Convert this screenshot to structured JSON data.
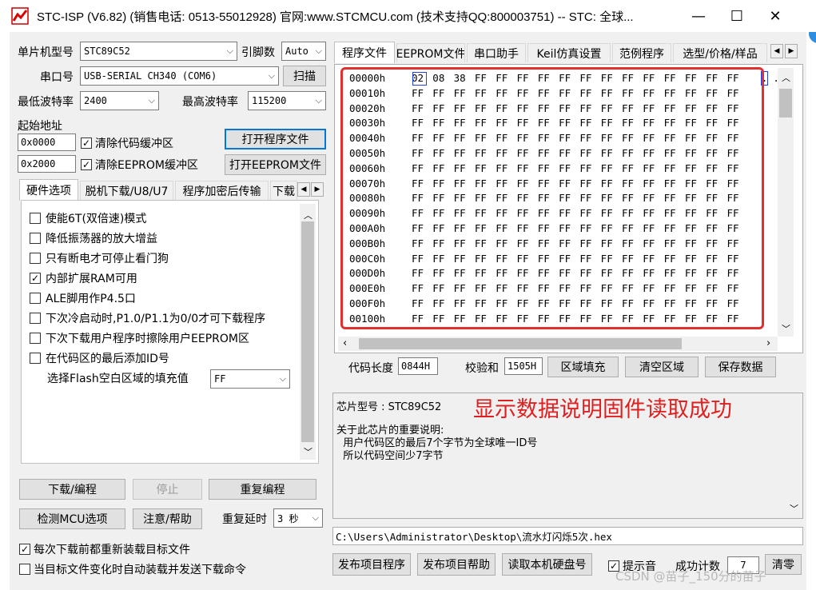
{
  "window": {
    "title": "STC-ISP (V6.82) (销售电话: 0513-55012928) 官网:www.STCMCU.com  (技术支持QQ:800003751)  -- STC: 全球...",
    "minimize": "—",
    "maximize": "☐",
    "close": "✕"
  },
  "left": {
    "mcu_label": "单片机型号",
    "mcu_value": "STC89C52",
    "pins_label": "引脚数",
    "pins_value": "Auto",
    "port_label": "串口号",
    "port_value": "USB-SERIAL CH340 (COM6)",
    "scan_button": "扫描",
    "min_baud_label": "最低波特率",
    "min_baud_value": "2400",
    "max_baud_label": "最高波特率",
    "max_baud_value": "115200",
    "start_addr_label": "起始地址",
    "addr1": "0x0000",
    "clear_code_label": "清除代码缓冲区",
    "open_prog_button": "打开程序文件",
    "addr2": "0x2000",
    "clear_eeprom_label": "清除EEPROM缓冲区",
    "open_eeprom_button": "打开EEPROM文件",
    "tabs": [
      "硬件选项",
      "脱机下载/U8/U7",
      "程序加密后传输",
      "下载"
    ],
    "options": [
      {
        "label": "使能6T(双倍速)模式",
        "checked": false
      },
      {
        "label": "降低振荡器的放大增益",
        "checked": false
      },
      {
        "label": "只有断电才可停止看门狗",
        "checked": false
      },
      {
        "label": "内部扩展RAM可用",
        "checked": true
      },
      {
        "label": "ALE脚用作P4.5口",
        "checked": false
      },
      {
        "label": "下次冷启动时,P1.0/P1.1为0/0才可下载程序",
        "checked": false
      },
      {
        "label": "下次下载用户程序时擦除用户EEPROM区",
        "checked": false
      },
      {
        "label": "在代码区的最后添加ID号",
        "checked": false
      }
    ],
    "fill_label": "选择Flash空白区域的填充值",
    "fill_value": "FF",
    "download_button": "下载/编程",
    "stop_button": "停止",
    "reprogram_button": "重复编程",
    "detect_button": "检测MCU选项",
    "help_button": "注意/帮助",
    "delay_label": "重复延时",
    "delay_value": "3 秒",
    "reload_label": "每次下载前都重新装载目标文件",
    "autoload_label": "当目标文件变化时自动装载并发送下载命令"
  },
  "right": {
    "tabs": [
      "程序文件",
      "EEPROM文件",
      "串口助手",
      "Keil仿真设置",
      "范例程序",
      "选型/价格/样品"
    ],
    "hex_rows": [
      {
        "addr": "00000h",
        "bytes": [
          "02",
          "08",
          "38",
          "FF",
          "FF",
          "FF",
          "FF",
          "FF",
          "FF",
          "FF",
          "FF",
          "FF",
          "FF",
          "FF",
          "FF",
          "FF"
        ]
      },
      {
        "addr": "00010h",
        "bytes": [
          "FF",
          "FF",
          "FF",
          "FF",
          "FF",
          "FF",
          "FF",
          "FF",
          "FF",
          "FF",
          "FF",
          "FF",
          "FF",
          "FF",
          "FF",
          "FF"
        ]
      },
      {
        "addr": "00020h",
        "bytes": [
          "FF",
          "FF",
          "FF",
          "FF",
          "FF",
          "FF",
          "FF",
          "FF",
          "FF",
          "FF",
          "FF",
          "FF",
          "FF",
          "FF",
          "FF",
          "FF"
        ]
      },
      {
        "addr": "00030h",
        "bytes": [
          "FF",
          "FF",
          "FF",
          "FF",
          "FF",
          "FF",
          "FF",
          "FF",
          "FF",
          "FF",
          "FF",
          "FF",
          "FF",
          "FF",
          "FF",
          "FF"
        ]
      },
      {
        "addr": "00040h",
        "bytes": [
          "FF",
          "FF",
          "FF",
          "FF",
          "FF",
          "FF",
          "FF",
          "FF",
          "FF",
          "FF",
          "FF",
          "FF",
          "FF",
          "FF",
          "FF",
          "FF"
        ]
      },
      {
        "addr": "00050h",
        "bytes": [
          "FF",
          "FF",
          "FF",
          "FF",
          "FF",
          "FF",
          "FF",
          "FF",
          "FF",
          "FF",
          "FF",
          "FF",
          "FF",
          "FF",
          "FF",
          "FF"
        ]
      },
      {
        "addr": "00060h",
        "bytes": [
          "FF",
          "FF",
          "FF",
          "FF",
          "FF",
          "FF",
          "FF",
          "FF",
          "FF",
          "FF",
          "FF",
          "FF",
          "FF",
          "FF",
          "FF",
          "FF"
        ]
      },
      {
        "addr": "00070h",
        "bytes": [
          "FF",
          "FF",
          "FF",
          "FF",
          "FF",
          "FF",
          "FF",
          "FF",
          "FF",
          "FF",
          "FF",
          "FF",
          "FF",
          "FF",
          "FF",
          "FF"
        ]
      },
      {
        "addr": "00080h",
        "bytes": [
          "FF",
          "FF",
          "FF",
          "FF",
          "FF",
          "FF",
          "FF",
          "FF",
          "FF",
          "FF",
          "FF",
          "FF",
          "FF",
          "FF",
          "FF",
          "FF"
        ]
      },
      {
        "addr": "00090h",
        "bytes": [
          "FF",
          "FF",
          "FF",
          "FF",
          "FF",
          "FF",
          "FF",
          "FF",
          "FF",
          "FF",
          "FF",
          "FF",
          "FF",
          "FF",
          "FF",
          "FF"
        ]
      },
      {
        "addr": "000A0h",
        "bytes": [
          "FF",
          "FF",
          "FF",
          "FF",
          "FF",
          "FF",
          "FF",
          "FF",
          "FF",
          "FF",
          "FF",
          "FF",
          "FF",
          "FF",
          "FF",
          "FF"
        ]
      },
      {
        "addr": "000B0h",
        "bytes": [
          "FF",
          "FF",
          "FF",
          "FF",
          "FF",
          "FF",
          "FF",
          "FF",
          "FF",
          "FF",
          "FF",
          "FF",
          "FF",
          "FF",
          "FF",
          "FF"
        ]
      },
      {
        "addr": "000C0h",
        "bytes": [
          "FF",
          "FF",
          "FF",
          "FF",
          "FF",
          "FF",
          "FF",
          "FF",
          "FF",
          "FF",
          "FF",
          "FF",
          "FF",
          "FF",
          "FF",
          "FF"
        ]
      },
      {
        "addr": "000D0h",
        "bytes": [
          "FF",
          "FF",
          "FF",
          "FF",
          "FF",
          "FF",
          "FF",
          "FF",
          "FF",
          "FF",
          "FF",
          "FF",
          "FF",
          "FF",
          "FF",
          "FF"
        ]
      },
      {
        "addr": "000E0h",
        "bytes": [
          "FF",
          "FF",
          "FF",
          "FF",
          "FF",
          "FF",
          "FF",
          "FF",
          "FF",
          "FF",
          "FF",
          "FF",
          "FF",
          "FF",
          "FF",
          "FF"
        ]
      },
      {
        "addr": "000F0h",
        "bytes": [
          "FF",
          "FF",
          "FF",
          "FF",
          "FF",
          "FF",
          "FF",
          "FF",
          "FF",
          "FF",
          "FF",
          "FF",
          "FF",
          "FF",
          "FF",
          "FF"
        ]
      },
      {
        "addr": "00100h",
        "bytes": [
          "FF",
          "FF",
          "FF",
          "FF",
          "FF",
          "FF",
          "FF",
          "FF",
          "FF",
          "FF",
          "FF",
          "FF",
          "FF",
          "FF",
          "FF",
          "FF"
        ]
      }
    ],
    "ascii_preview": ". .",
    "code_len_label": "代码长度",
    "code_len_value": "0844H",
    "checksum_label": "校验和",
    "checksum_value": "1505H",
    "fill_button": "区域填充",
    "clear_button": "清空区域",
    "save_button": "保存数据",
    "info_line1": "芯片型号 : STC89C52",
    "info_line2": "关于此芯片的重要说明:",
    "info_line3": "  用户代码区的最后7个字节为全球唯一ID号",
    "info_line4": "  所以代码空间少7字节",
    "annotation": "显示数据说明固件读取成功",
    "file_path": "C:\\Users\\Administrator\\Desktop\\流水灯闪烁5次.hex",
    "publish_prog_button": "发布项目程序",
    "publish_help_button": "发布项目帮助",
    "read_disk_button": "读取本机硬盘号",
    "beep_label": "提示音",
    "success_label": "成功计数",
    "success_value": "7",
    "reset_button": "清零",
    "watermark": "CSDN @苗子_150分的苗子"
  },
  "colors": {
    "accent": "#0078d7",
    "annotation_red": "#e02020",
    "box_red": "#e03030"
  }
}
